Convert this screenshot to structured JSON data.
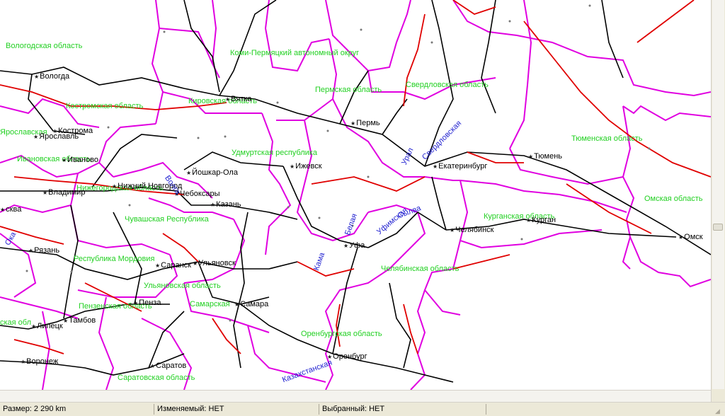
{
  "map": {
    "colors": {
      "border": "#e000e0",
      "rail": "#000000",
      "road": "#e00000",
      "region_label": "#22d022",
      "road_label": "#1f1fd0",
      "city_label": "#000000",
      "capital_marker": "#1a1a1a"
    },
    "regions": [
      {
        "name": "Вологодская область"
      },
      {
        "name": "Коми-Пермяцкий автономный округ"
      },
      {
        "name": "Костромская область"
      },
      {
        "name": "Кировская область"
      },
      {
        "name": "Пермская область"
      },
      {
        "name": "Свердловская область"
      },
      {
        "name": "Тюменская область"
      },
      {
        "name": "Удмуртская республика"
      },
      {
        "name": "Ивановская область"
      },
      {
        "name": "Нижегородская область"
      },
      {
        "name": "Чувашская Республика"
      },
      {
        "name": "Курганская область"
      },
      {
        "name": "Омская область"
      },
      {
        "name": "Республика Мордовия"
      },
      {
        "name": "Челябинская область"
      },
      {
        "name": "Ульяновская область"
      },
      {
        "name": "Пензенская область"
      },
      {
        "name": "Самарская"
      },
      {
        "name": "Оренбургская область"
      },
      {
        "name": "Саратовская область"
      },
      {
        "name": "ская обл"
      },
      {
        "name": "Ярославская"
      }
    ],
    "cities": [
      {
        "name": "Вологда"
      },
      {
        "name": "Вятка"
      },
      {
        "name": "Кострома"
      },
      {
        "name": "Ярославль"
      },
      {
        "name": "Иваново"
      },
      {
        "name": "Пермь"
      },
      {
        "name": "Екатеринбург"
      },
      {
        "name": "Тюмень"
      },
      {
        "name": "Ижевск"
      },
      {
        "name": "Йошкар-Ола"
      },
      {
        "name": "Нижний Новгород"
      },
      {
        "name": "Чебоксары"
      },
      {
        "name": "Владимир"
      },
      {
        "name": "Казань"
      },
      {
        "name": "Курган"
      },
      {
        "name": "Челябинск"
      },
      {
        "name": "Омск"
      },
      {
        "name": "Рязань"
      },
      {
        "name": "Саранск"
      },
      {
        "name": "Ульяновск"
      },
      {
        "name": "Уфа"
      },
      {
        "name": "Пенза"
      },
      {
        "name": "Самара"
      },
      {
        "name": "Тамбов"
      },
      {
        "name": "Липецк"
      },
      {
        "name": "Оренбург"
      },
      {
        "name": "Воронеж"
      },
      {
        "name": "Саратов"
      },
      {
        "name": "сква"
      }
    ],
    "roads": [
      {
        "name": "Кама"
      },
      {
        "name": "Белая"
      },
      {
        "name": "Уфимская"
      },
      {
        "name": "Урал"
      },
      {
        "name": "Казахстанская"
      },
      {
        "name": "Волга"
      },
      {
        "name": "Ока"
      },
      {
        "name": "Свердловская"
      },
      {
        "name": "Сылва"
      }
    ]
  },
  "status": {
    "size": "Размер: 2 290 km",
    "modified": "Изменяемый: НЕТ",
    "selected": "Выбранный: НЕТ"
  }
}
